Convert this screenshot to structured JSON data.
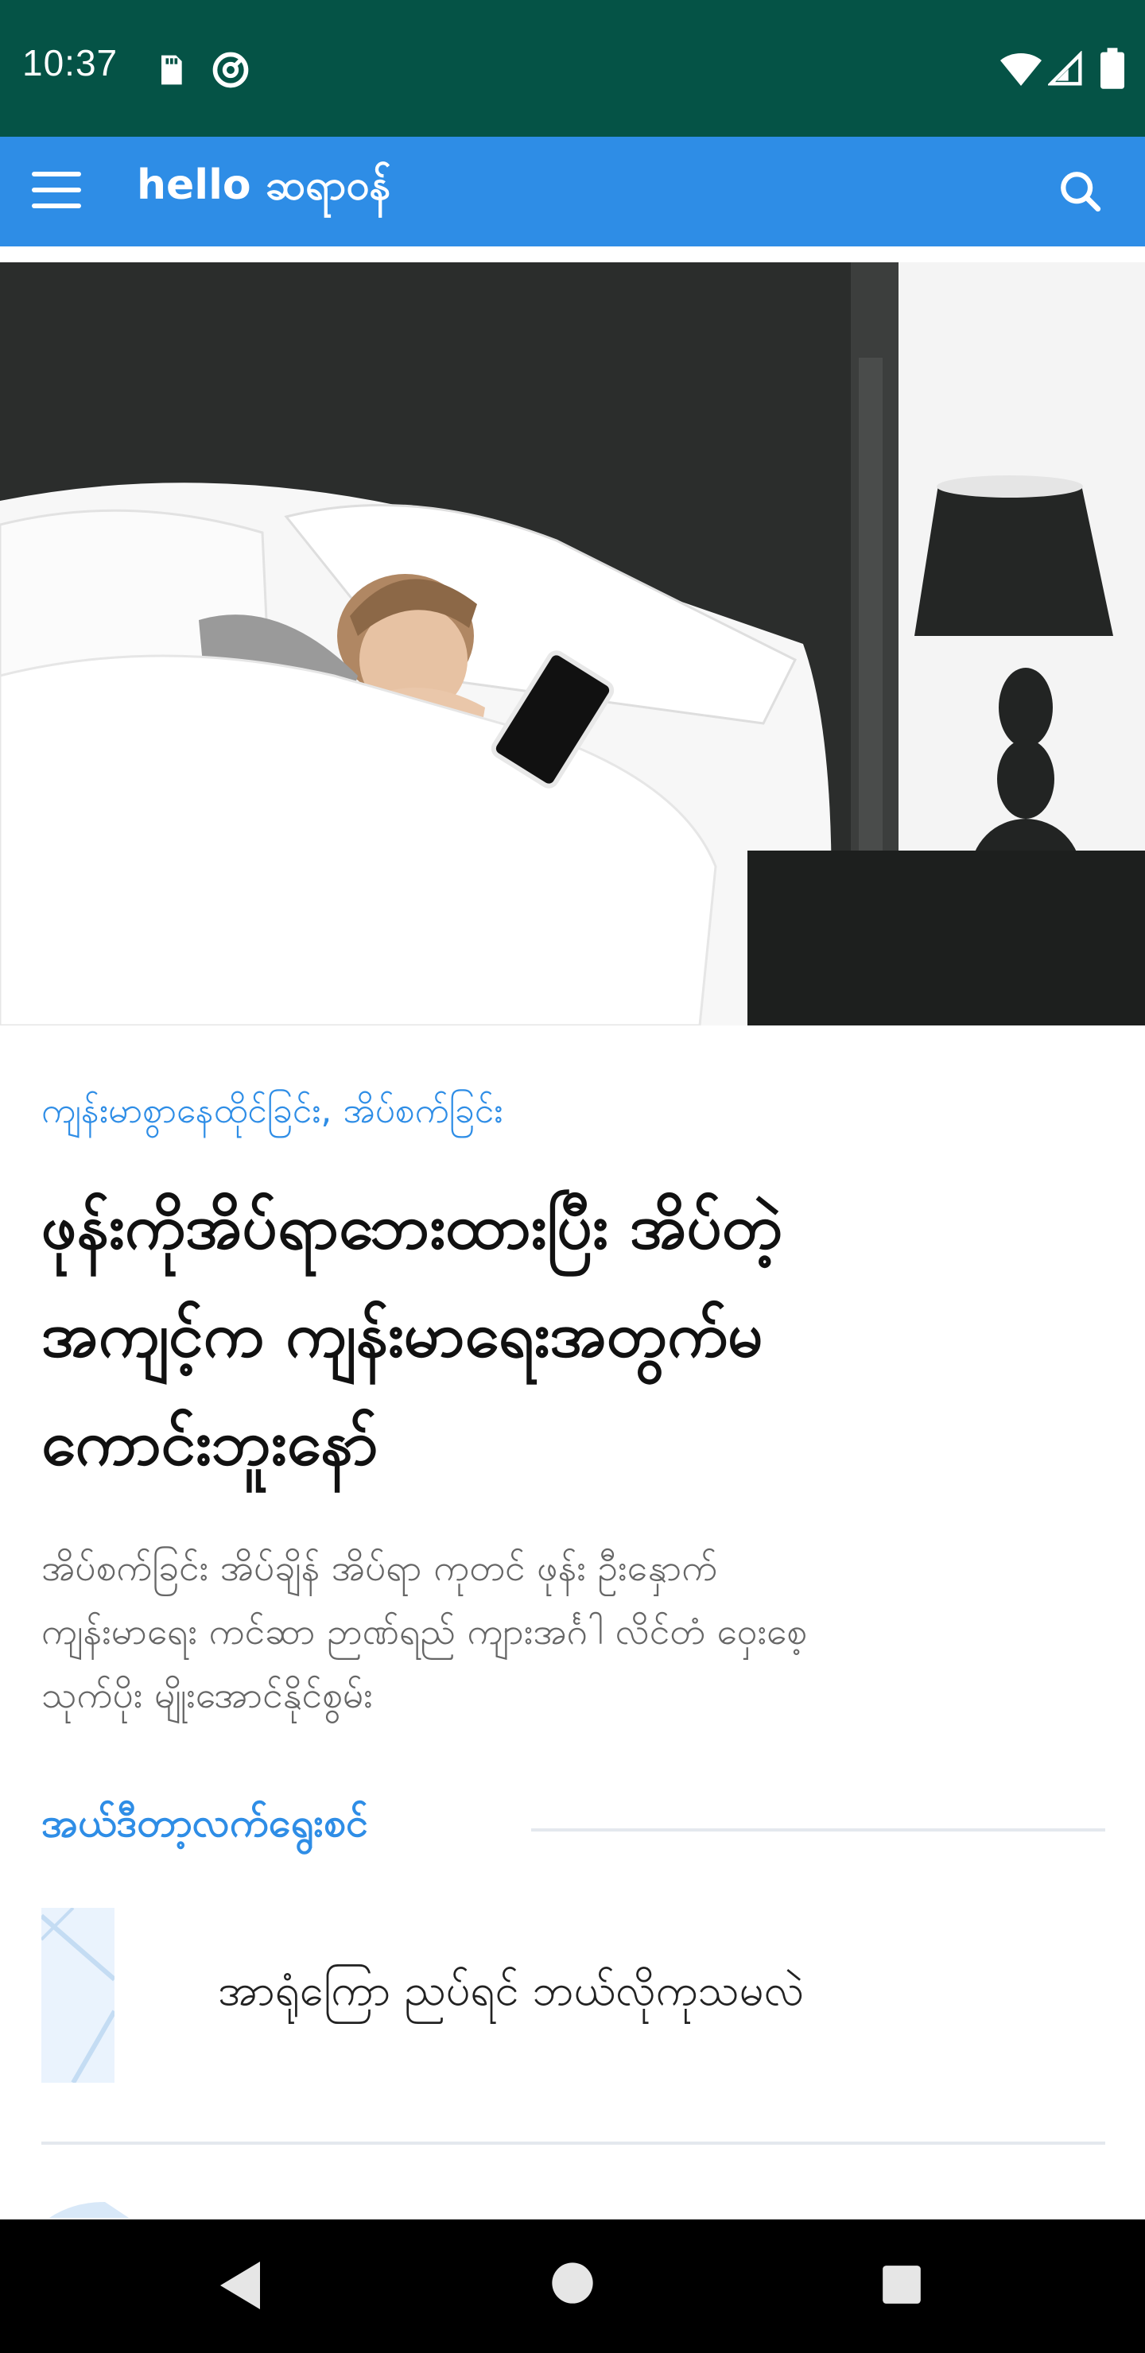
{
  "status_bar": {
    "time": "10:37",
    "icons": [
      "sd-card-icon",
      "at-sign-icon",
      "wifi-icon",
      "signal-icon",
      "battery-icon"
    ]
  },
  "app_bar": {
    "brand": "hello ဆရာဝန်",
    "icons": [
      "menu-icon",
      "search-icon"
    ],
    "color": "#2e8de6"
  },
  "hero": {
    "alt": "woman-sleeping-next-to-phone-image"
  },
  "article": {
    "category": "ကျန်းမာစွာနေထိုင်ခြင်း, အိပ်စက်ခြင်း",
    "headline_lines": [
      "ဖုန်းကိုအိပ်ရာဘေးထားပြီး အိပ်တဲ့",
      "အကျင့်က ကျန်းမာရေးအတွက်မ",
      "ကောင်းဘူးနော်"
    ],
    "tags_lines": [
      "အိပ်စက်ခြင်း အိပ်ချိန် အိပ်ရာ ကုတင် ဖုန်း ဦးနှောက်",
      "ကျန်းမာရေး ကင်ဆာ ဉာဏ်ရည် ကျားအင်္ဂါ လိင်တံ ဝှေးစေ့",
      "သုက်ပိုး မျိုးအောင်နိုင်စွမ်း"
    ]
  },
  "section": {
    "title": "အယ်ဒီတာ့လက်ရွေးစင်",
    "items": [
      {
        "title": "အာရုံကြော ညပ်ရင် ဘယ်လိုကုသမလဲ"
      }
    ]
  },
  "nav_bar": {
    "icons": [
      "back-icon",
      "home-icon",
      "recents-icon"
    ]
  },
  "colors": {
    "status_bar": "#055346",
    "accent": "#2e8de6",
    "text": "#111111",
    "muted": "#666666"
  }
}
